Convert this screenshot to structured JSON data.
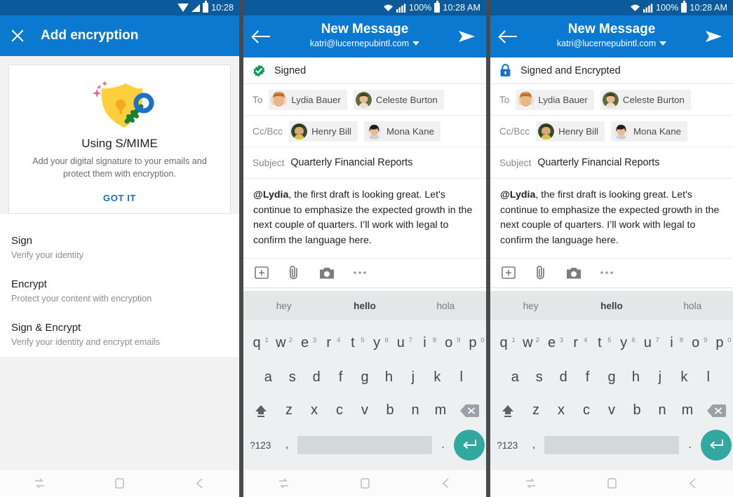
{
  "panels": [
    {
      "id": "add-encryption",
      "statusbar": {
        "time": "10:28",
        "icons": [
          "wifi-icon",
          "signal-icon",
          "battery-icon"
        ]
      },
      "appbar": {
        "close_label": "close-icon",
        "title": "Add encryption"
      },
      "card": {
        "illustration": "shield-key-icon",
        "title": "Using S/MIME",
        "description": "Add your digital signature to your emails and protect them with encryption.",
        "action_label": "GOT IT"
      },
      "options": [
        {
          "title": "Sign",
          "subtitle": "Verify your identity"
        },
        {
          "title": "Encrypt",
          "subtitle": "Protect your content with encryption"
        },
        {
          "title": "Sign & Encrypt",
          "subtitle": "Verify your identity and encrypt emails"
        }
      ]
    },
    {
      "id": "compose-signed",
      "statusbar": {
        "wifi": "wifi-icon",
        "signal": "signal-icon",
        "battery_percent": "100%",
        "time": "10:28 AM"
      },
      "appbar": {
        "back": "back-arrow-icon",
        "title": "New Message",
        "account": "katri@lucernepubintl.com",
        "dropdown": "chevron-down-icon",
        "send": "send-icon"
      },
      "security": {
        "icon": "verified-badge-icon",
        "icon_color": "#0f9d58",
        "label": "Signed"
      },
      "fields": {
        "to_label": "To",
        "to": [
          {
            "name": "Lydia Bauer"
          },
          {
            "name": "Celeste Burton"
          }
        ],
        "ccbcc_label": "Cc/Bcc",
        "ccbcc": [
          {
            "name": "Henry Bill"
          },
          {
            "name": "Mona Kane"
          }
        ],
        "subject_label": "Subject",
        "subject_value": "Quarterly Financial Reports"
      },
      "body": {
        "mention": "@Lydia",
        "text": ", the first draft is looking great. Let's continue to emphasize the expected growth in the next couple of quarters. I’ll work with legal to confirm the language here."
      },
      "attach_icons": [
        "insert-icon",
        "paperclip-icon",
        "camera-icon",
        "more-options-icon"
      ]
    },
    {
      "id": "compose-signed-encrypted",
      "statusbar": {
        "wifi": "wifi-icon",
        "signal": "signal-icon",
        "battery_percent": "100%",
        "time": "10:28 AM"
      },
      "appbar": {
        "back": "back-arrow-icon",
        "title": "New Message",
        "account": "katri@lucernepubintl.com",
        "dropdown": "chevron-down-icon",
        "send": "send-icon"
      },
      "security": {
        "icon": "lock-icon",
        "icon_color": "#1a73c7",
        "label": "Signed and Encrypted"
      },
      "fields": {
        "to_label": "To",
        "to": [
          {
            "name": "Lydia Bauer"
          },
          {
            "name": "Celeste Burton"
          }
        ],
        "ccbcc_label": "Cc/Bcc",
        "ccbcc": [
          {
            "name": "Henry Bill"
          },
          {
            "name": "Mona Kane"
          }
        ],
        "subject_label": "Subject",
        "subject_value": "Quarterly Financial Reports"
      },
      "body": {
        "mention": "@Lydia",
        "text": ", the first draft is looking great. Let's continue to emphasize the expected growth in the next couple of quarters. I’ll work with legal to confirm the language here."
      },
      "attach_icons": [
        "insert-icon",
        "paperclip-icon",
        "camera-icon",
        "more-options-icon"
      ]
    }
  ],
  "keyboard": {
    "suggestions": [
      "hey",
      "hello",
      "hola"
    ],
    "row1": [
      {
        "k": "q",
        "n": "1"
      },
      {
        "k": "w",
        "n": "2"
      },
      {
        "k": "e",
        "n": "3"
      },
      {
        "k": "r",
        "n": "4"
      },
      {
        "k": "t",
        "n": "5"
      },
      {
        "k": "y",
        "n": "6"
      },
      {
        "k": "u",
        "n": "7"
      },
      {
        "k": "i",
        "n": "8"
      },
      {
        "k": "o",
        "n": "9"
      },
      {
        "k": "p",
        "n": "0"
      }
    ],
    "row2": [
      "a",
      "s",
      "d",
      "f",
      "g",
      "h",
      "j",
      "k",
      "l"
    ],
    "row3": [
      "z",
      "x",
      "c",
      "v",
      "b",
      "n",
      "m"
    ],
    "shift_label": "shift-icon",
    "backspace_label": "backspace-icon",
    "symbols_label": "?123",
    "comma_label": ",",
    "period_label": ".",
    "enter_label": "enter-icon",
    "space_label": "space-bar"
  },
  "navbar": {
    "recents": "recents-icon",
    "home": "home-icon",
    "back": "back-icon"
  },
  "colors": {
    "appbar_blue": "#0b79d0",
    "statusbar_blue": "#0a5a9c",
    "accent_link": "#1a73c7",
    "signed_green": "#0f9d58",
    "enter_teal": "#33a8a0"
  }
}
